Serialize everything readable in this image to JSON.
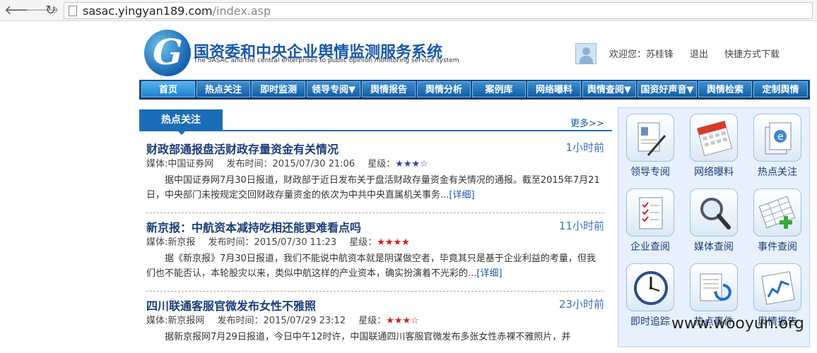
{
  "browser": {
    "url_host": "sasac.yingyan189.com",
    "url_path": "/index.asp"
  },
  "header": {
    "title": "国资委和中央企业舆情监测服务系统",
    "subtitle": "The SASAC and the central enterprises to public opinion monitoring service system",
    "welcome": "欢迎您：苏桂锋",
    "logout": "退出",
    "shortcut": "快捷方式下载"
  },
  "nav": [
    {
      "label": "首页"
    },
    {
      "label": "热点关注"
    },
    {
      "label": "即时监测"
    },
    {
      "label": "领导专阅▼"
    },
    {
      "label": "舆情报告"
    },
    {
      "label": "舆情分析"
    },
    {
      "label": "案例库"
    },
    {
      "label": "网络曝料"
    },
    {
      "label": "舆情查阅▼"
    },
    {
      "label": "国资好声音▼"
    },
    {
      "label": "舆情检索"
    },
    {
      "label": "定制舆情"
    }
  ],
  "hot": {
    "tab": "热点关注",
    "more": "更多>>",
    "items": [
      {
        "title": "财政部通报盘活财政存量资金有关情况",
        "ago": "1小时前",
        "media": "媒体:中国证券网",
        "published": "发布时间：2015/07/30 21:06",
        "rating_label": "星级：",
        "stars": "★★★☆",
        "body": "据中国证券网7月30日报道，财政部于近日发布关于盘活财政存量资金有关情况的通报。截至2015年7月21日，中央部门未按规定交回财政存量资金的依次为中共中央直属机关事务...",
        "detail": "[详细]"
      },
      {
        "title": "新京报：中航资本减持吃相还能更难看点吗",
        "ago": "11小时前",
        "media": "媒体:新京报",
        "published": "发布时间：2015/07/30 11:23",
        "rating_label": "星级：",
        "stars": "★★★★",
        "body": "据《新京报》7月30日报道，我们不能说中航资本就是阴谋做空者，毕竟其只是基于企业利益的考量，但我们也不能否认，本轮股灾以来，类似中航这样的产业资本，确实扮演着不光彩的...",
        "detail": "[详细]"
      },
      {
        "title": "四川联通客服官微发布女性不雅照",
        "ago": "23小时前",
        "media": "媒体:新京报网",
        "published": "发布时间：2015/07/29 23:12",
        "rating_label": "星级：",
        "stars": "★★★☆",
        "body": "据新京报网7月29日报道，今日中午12时许，中国联通四川客服官微发布多张女性赤裸不雅照片，并",
        "detail": ""
      }
    ]
  },
  "side": {
    "tiles": [
      {
        "label": "领导专阅",
        "icon": "document-pen-icon"
      },
      {
        "label": "网络曝料",
        "icon": "calendar-icon"
      },
      {
        "label": "热点关注",
        "icon": "ie-document-icon"
      },
      {
        "label": "企业查阅",
        "icon": "checklist-icon"
      },
      {
        "label": "媒体查阅",
        "icon": "magnifier-icon"
      },
      {
        "label": "事件查阅",
        "icon": "spreadsheet-add-icon"
      },
      {
        "label": "即时追踪",
        "icon": "clock-icon"
      },
      {
        "label": "热点事件",
        "icon": "document-refresh-icon"
      },
      {
        "label": "舆情报告",
        "icon": "chart-book-icon"
      }
    ]
  },
  "watermark": "www.wooyun.org"
}
